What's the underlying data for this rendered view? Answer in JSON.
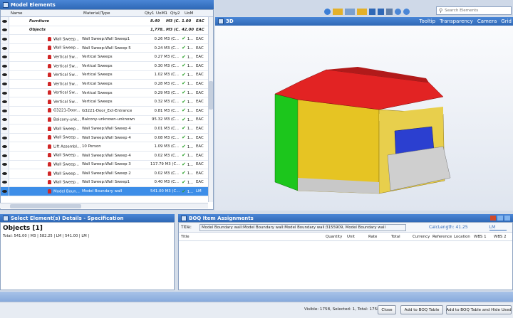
{
  "model_panel": {
    "title": "Model Elements",
    "columns": [
      "Name",
      "Material/Type",
      "Qty1",
      "UoM1",
      "Qty2",
      "UoM"
    ],
    "group_rows": [
      {
        "name": "Furniture",
        "qty1": "8.49",
        "uom1": "M3 (C...",
        "qty2": "1.00",
        "uom2": "EAC"
      },
      {
        "name": "Objects",
        "qty1": "1,778...",
        "uom1": "M3 (C...",
        "qty2": "42.00",
        "uom2": "EAC"
      }
    ],
    "rows": [
      {
        "name": "Wall Sweep...",
        "type": "Wall Sweep:Wall Sweep1",
        "qty1": "0.26 M3 (C...",
        "qty2": "1...",
        "uom": "EAC"
      },
      {
        "name": "Wall Sweep...",
        "type": "Wall Sweep:Wall Sweep 5",
        "qty1": "0.24 M3 (C...",
        "qty2": "1...",
        "uom": "EAC"
      },
      {
        "name": "Vertical Sw...",
        "type": "Vertical Sweeps",
        "qty1": "0.27 M3 (C...",
        "qty2": "1...",
        "uom": "EAC"
      },
      {
        "name": "Vertical Sw...",
        "type": "Vertical Sweeps",
        "qty1": "0.30 M3 (C...",
        "qty2": "1...",
        "uom": "EAC"
      },
      {
        "name": "Vertical Sw...",
        "type": "Vertical Sweeps",
        "qty1": "1.02 M3 (C...",
        "qty2": "1...",
        "uom": "EAC"
      },
      {
        "name": "Vertical Sw...",
        "type": "Vertical Sweeps",
        "qty1": "0.28 M3 (C...",
        "qty2": "1...",
        "uom": "EAC"
      },
      {
        "name": "Vertical Sw...",
        "type": "Vertical Sweeps",
        "qty1": "0.29 M3 (C...",
        "qty2": "1...",
        "uom": "EAC"
      },
      {
        "name": "Vertical Sw...",
        "type": "Vertical Sweeps",
        "qty1": "0.32 M3 (C...",
        "qty2": "1...",
        "uom": "EAC"
      },
      {
        "name": "G3221-Door...",
        "type": "G3221-Door_Ext-Entrance",
        "qty1": "0.81 M3 (C...",
        "qty2": "1...",
        "uom": "EAC"
      },
      {
        "name": "Balcony-unk...",
        "type": "Balcony-unknown-unknown",
        "qty1": "95.32 M3 (C...",
        "qty2": "1...",
        "uom": "EAC"
      },
      {
        "name": "Wall Sweep...",
        "type": "Wall Sweep:Wall Sweep 4",
        "qty1": "0.01 M3 (C...",
        "qty2": "1...",
        "uom": "EAC"
      },
      {
        "name": "Wall Sweep...",
        "type": "Wall Sweep:Wall Sweep 4",
        "qty1": "0.08 M3 (C...",
        "qty2": "1...",
        "uom": "EAC"
      },
      {
        "name": "Lift Assembl...",
        "type": "10 Person",
        "qty1": "1.09 M3 (C...",
        "qty2": "1...",
        "uom": "EAC"
      },
      {
        "name": "Wall Sweep...",
        "type": "Wall Sweep:Wall Sweep 4",
        "qty1": "0.02 M3 (C...",
        "qty2": "1...",
        "uom": "EAC"
      },
      {
        "name": "Wall Sweep...",
        "type": "Wall Sweep:Wall Sweep 3",
        "qty1": "117.79 M3 (C...",
        "qty2": "1...",
        "uom": "EAC"
      },
      {
        "name": "Wall Sweep...",
        "type": "Wall Sweep:Wall Sweep 2",
        "qty1": "0.02 M3 (C...",
        "qty2": "1...",
        "uom": "EAC"
      },
      {
        "name": "Wall Sweep...",
        "type": "Wall Sweep:Wall Sweep1",
        "qty1": "0.40 M3 (C...",
        "qty2": "1...",
        "uom": "EAC"
      },
      {
        "name": "Model Boun...",
        "type": "Model Boundary wall",
        "qty1": "541.00 M3 (C...",
        "qty2": "1...",
        "uom": "LM",
        "selected": true
      }
    ]
  },
  "viewport": {
    "tab": "3D",
    "tooltip": "Tooltip",
    "transparency": "Transparency",
    "camera": "Camera",
    "grid": "Grid",
    "search_placeholder": "Search Elements"
  },
  "spec_panel": {
    "title": "Select Element(s) Details - Specification",
    "heading": "Objects [1]",
    "total": "Total: 541.00 | M3 | 582.25 | LM | 541.00 | LM |"
  },
  "boq_panel": {
    "title": "BOQ Item Assignments",
    "title_label": "Title:",
    "title_value": "Model Boundary wall:Model Boundary wall:Model Boundary wall:3155909, Model Boundary wall",
    "calc_length": "CalcLength: 41.25",
    "unit": "LM",
    "columns": [
      "Title",
      "Quantity",
      "Unit",
      "Rate",
      "Total",
      "Currency",
      "Reference",
      "Location",
      "WBS 1",
      "WBS 2"
    ]
  },
  "footer": {
    "status": "Visible: 1758, Selected: 1, Total: 1758",
    "close": "Close",
    "add": "Add to BOQ Table",
    "add_hide": "Add to BOQ Table and Hide Used"
  }
}
